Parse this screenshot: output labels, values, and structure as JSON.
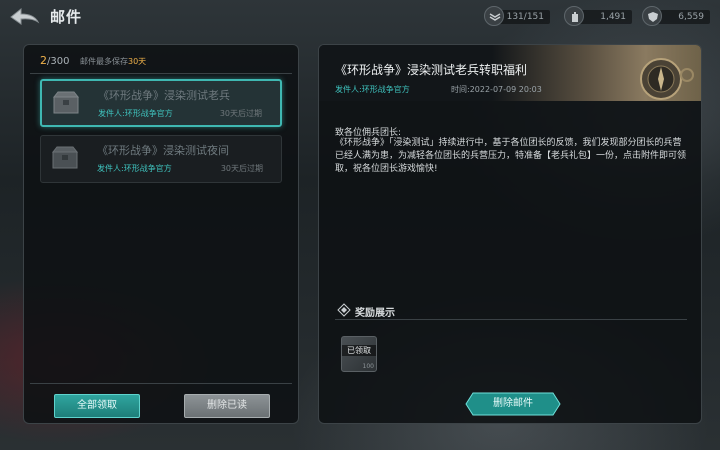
{
  "header": {
    "title": "邮件"
  },
  "resources": [
    {
      "icon": "rank-icon",
      "value": "131/151"
    },
    {
      "icon": "tower-icon",
      "value": "1,491"
    },
    {
      "icon": "shield-icon",
      "value": "6,559"
    }
  ],
  "mailbox": {
    "count_current": "2",
    "count_total": "/300",
    "keep_prefix": "邮件最多保存",
    "keep_days": "30天"
  },
  "mails": [
    {
      "title": "《环形战争》浸染测试老兵",
      "sender": "发件人:环形战争官方",
      "expiry": "30天后过期",
      "selected": true
    },
    {
      "title": "《环形战争》浸染测试夜间",
      "sender": "发件人:环形战争官方",
      "expiry": "30天后过期",
      "selected": false
    }
  ],
  "buttons": {
    "claim_all": "全部领取",
    "delete_read": "删除已读",
    "delete_mail": "删除邮件"
  },
  "detail": {
    "title": "《环形战争》浸染测试老兵转职福利",
    "sender": "发件人:环形战争官方",
    "time": "时间:2022-07-09 20:03",
    "greeting": "致各位佣兵团长:",
    "body": "《环形战争》「浸染测试」持续进行中，基于各位团长的反馈，我们发现部分团长的兵营已经人满为患，为减轻各位团长的兵营压力，特准备【老兵礼包】一份，点击附件即可领取，祝各位团长游戏愉快!",
    "reward_title": "奖励展示",
    "reward": {
      "status": "已领取",
      "quantity": "100"
    }
  },
  "colors": {
    "accent": "#3fc4bf",
    "highlight": "#f0b24a"
  }
}
